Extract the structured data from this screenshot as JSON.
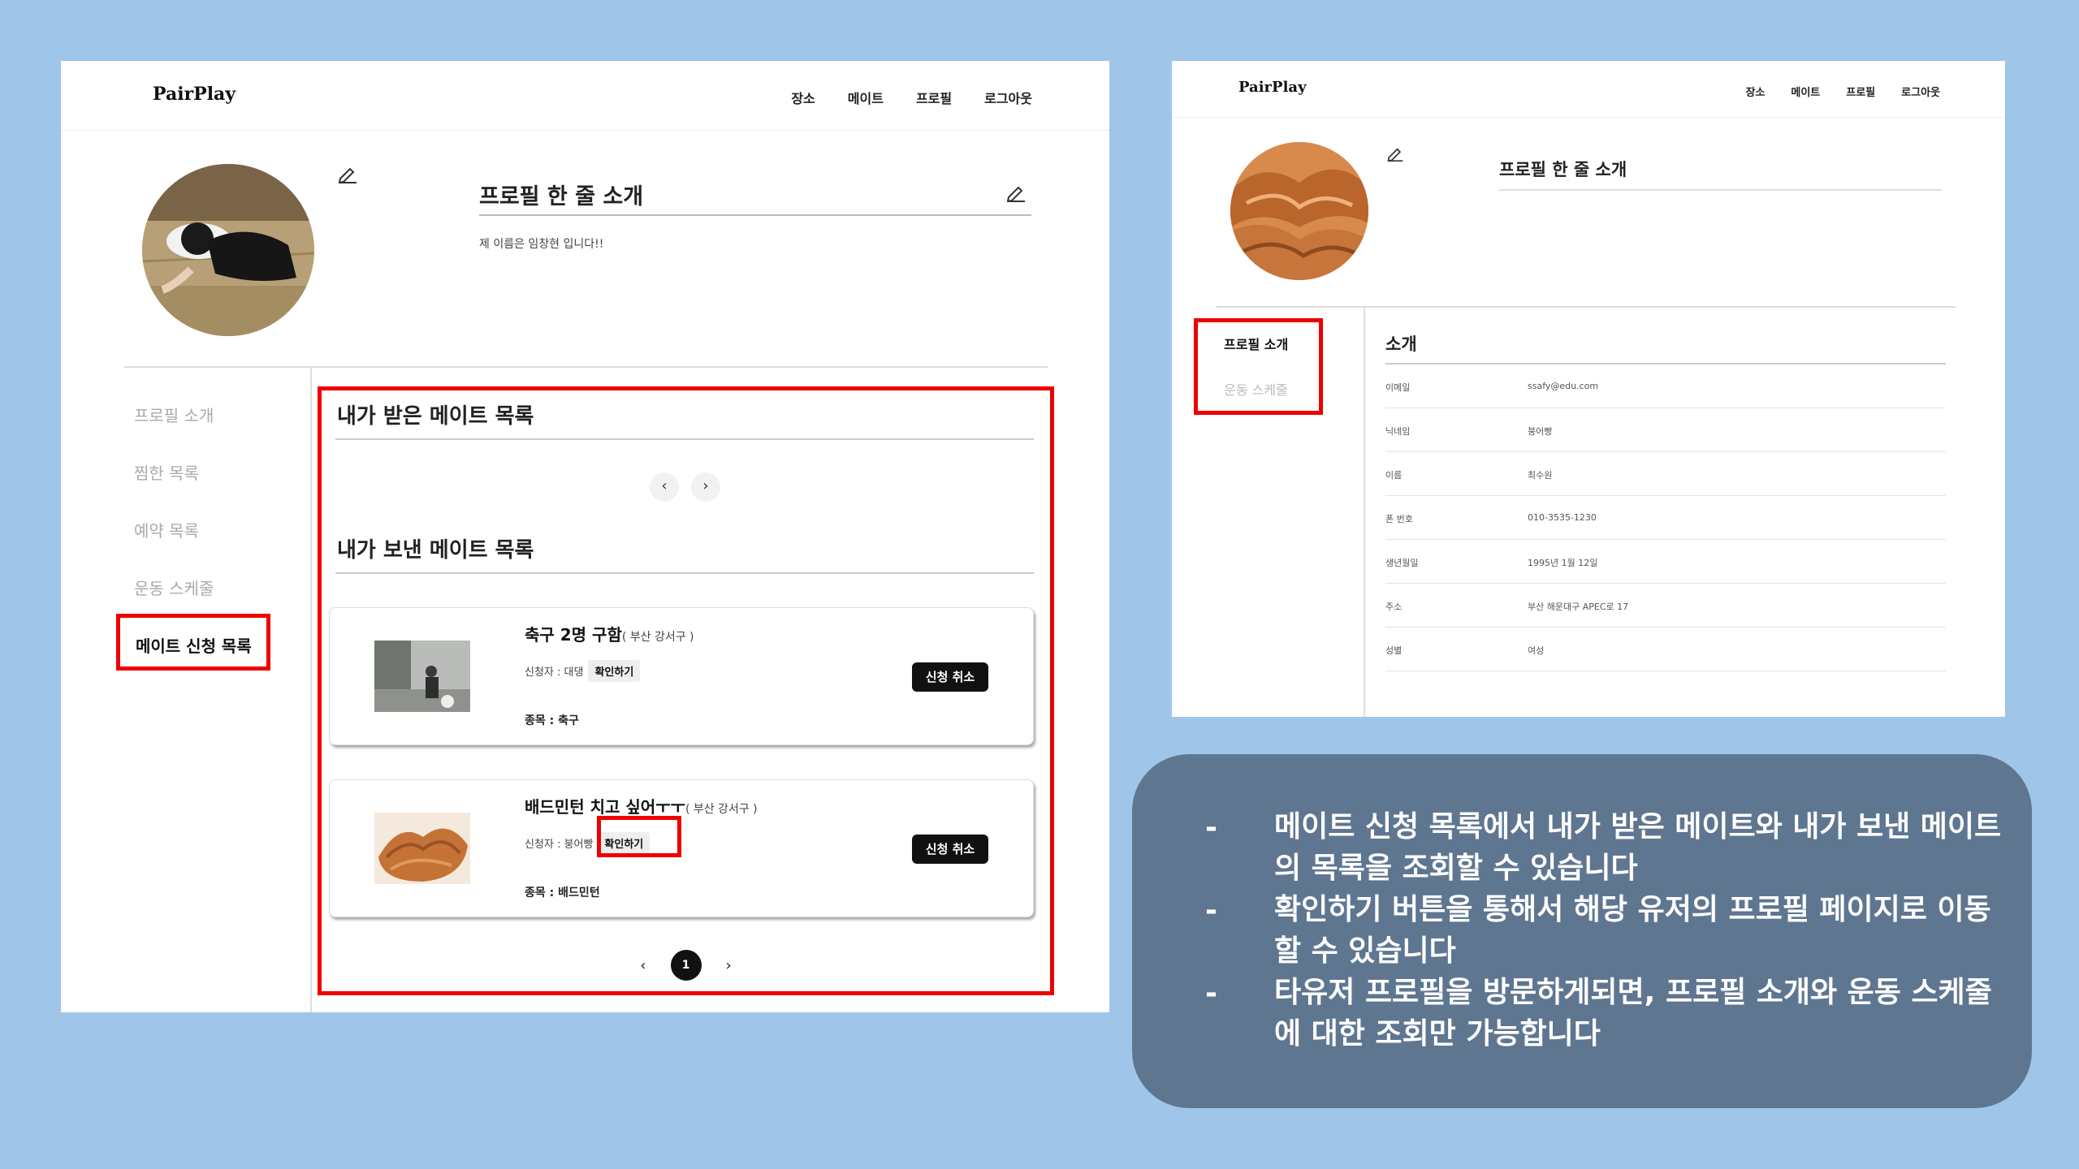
{
  "left_screen": {
    "logo": "PairPlay",
    "nav": [
      "장소",
      "메이트",
      "프로필",
      "로그아웃"
    ],
    "intro_title": "프로필 한 줄 소개",
    "intro_text": "제 이름은 임창현 입니다!!",
    "sidebar": [
      "프로필 소개",
      "찜한 목록",
      "예약 목록",
      "운동 스케줄",
      "메이트 신청 목록"
    ],
    "received_title": "내가 받은 메이트 목록",
    "sent_title": "내가 보낸 메이트 목록",
    "prev_icon": "‹",
    "next_icon": "›",
    "cards": [
      {
        "title": "축구 2명 구함",
        "location": "( 부산 강서구 )",
        "applicant": "신청자 : 대댕",
        "confirm": "확인하기",
        "sport": "종목 : 축구",
        "cancel": "신청 취소"
      },
      {
        "title": "배드민턴 치고 싶어ㅜㅜ",
        "location": "( 부산 강서구 )",
        "applicant": "신청자 : 붕어빵",
        "confirm": "확인하기",
        "sport": "종목 : 배드민턴",
        "cancel": "신청 취소"
      }
    ],
    "pager": {
      "prev": "‹",
      "current": "1",
      "next": "›"
    }
  },
  "right_screen": {
    "logo": "PairPlay",
    "nav": [
      "장소",
      "메이트",
      "프로필",
      "로그아웃"
    ],
    "intro_title": "프로필 한 줄 소개",
    "sidebar": [
      "프로필 소개",
      "운동 스케줄"
    ],
    "info_title": "소개",
    "info": [
      {
        "key": "이메일",
        "value": "ssafy@edu.com"
      },
      {
        "key": "닉네임",
        "value": "붕어빵"
      },
      {
        "key": "이름",
        "value": "최수원"
      },
      {
        "key": "폰 번호",
        "value": "010-3535-1230"
      },
      {
        "key": "생년월일",
        "value": "1995년 1월 12일"
      },
      {
        "key": "주소",
        "value": "부산 해운대구 APEC로 17"
      },
      {
        "key": "성별",
        "value": "여성"
      }
    ]
  },
  "notes": {
    "dash": "-",
    "items": [
      "메이트 신청 목록에서 내가 받은 메이트와 내가 보낸 메이트의 목록을 조회할 수 있습니다",
      "확인하기 버튼을 통해서 해당 유저의 프로필 페이지로 이동할 수 있습니다",
      "타유저 프로필을 방문하게되면, 프로필 소개와 운동 스케줄에 대한 조회만 가능합니다"
    ]
  },
  "colors": {
    "background": "#9fc5e8",
    "highlight": "#ee0000",
    "note_box": "#5f7691"
  }
}
